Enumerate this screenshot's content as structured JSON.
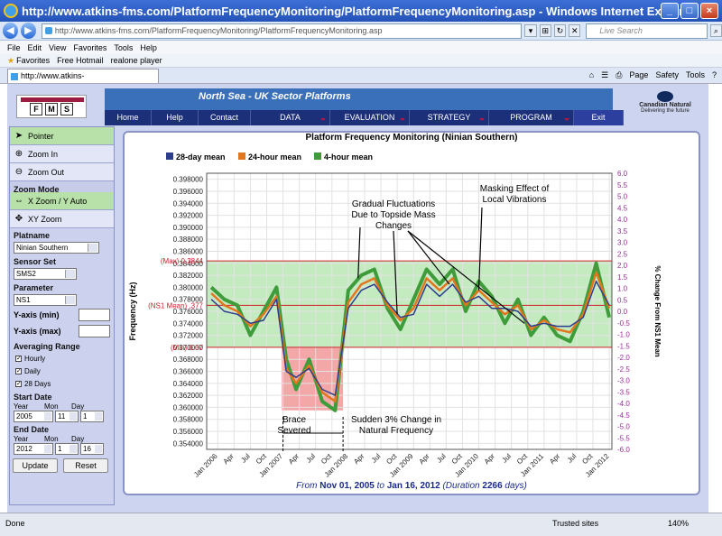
{
  "window": {
    "title": "http://www.atkins-fms.com/PlatformFrequencyMonitoring/PlatformFrequencyMonitoring.asp - Windows Internet Explorer"
  },
  "address": {
    "url": "http://www.atkins-fms.com/PlatformFrequencyMonitoring/PlatformFrequencyMonitoring.asp",
    "search_placeholder": "Live Search"
  },
  "menu": [
    "File",
    "Edit",
    "View",
    "Favorites",
    "Tools",
    "Help"
  ],
  "favorites": [
    "Favorites",
    "Free Hotmail",
    "realone player"
  ],
  "tab": {
    "label": "http://www.atkins-fms.com/PlatformFreque..."
  },
  "commands": [
    "Page",
    "Safety",
    "Tools"
  ],
  "app": {
    "logo_letters": [
      "F",
      "M",
      "S"
    ],
    "brand": "North Sea - UK Sector Platforms",
    "partner": "Canadian Natural",
    "partner_sub": "Delivering the future",
    "nav": [
      "Home",
      "Help",
      "Contact",
      "DATA",
      "EVALUATION",
      "STRATEGY",
      "PROGRAM",
      "Exit"
    ]
  },
  "sidebar": {
    "tools": [
      "Pointer",
      "Zoom In",
      "Zoom Out"
    ],
    "zoom_mode_label": "Zoom Mode",
    "zoom_modes": [
      "X Zoom / Y Auto",
      "XY Zoom"
    ],
    "platname_label": "Platname",
    "platname_value": "Ninian Southern",
    "sensor_label": "Sensor Set",
    "sensor_value": "SMS2",
    "parameter_label": "Parameter",
    "parameter_value": "NS1",
    "ymin_label": "Y-axis (min)",
    "ymax_label": "Y-axis (max)",
    "averaging_label": "Averaging Range",
    "averaging": [
      "Hourly",
      "Daily",
      "28 Days"
    ],
    "start_label": "Start Date",
    "end_label": "End Date",
    "col_labels": [
      "Year",
      "Mon",
      "Day"
    ],
    "start": [
      "2005",
      "11",
      "1"
    ],
    "end": [
      "2012",
      "1",
      "16"
    ],
    "update": "Update",
    "reset": "Reset"
  },
  "chart_title": "Platform Frequency Monitoring (Ninian Southern)",
  "footer": {
    "pre": "From",
    "from": "Nov 01, 2005",
    "mid": "to",
    "to": "Jan 16, 2012",
    "duration_pre": "(Duration",
    "duration": "2266",
    "duration_post": "days)"
  },
  "status": {
    "left": "Done",
    "trusted": "Trusted sites",
    "zoom": "140%"
  },
  "colors": {
    "c28": "#2c3e8c",
    "c24": "#e2761f",
    "c4": "#3e9c3a",
    "bandGreen": "#c4ebc0",
    "bandRed": "#f3a7a7",
    "refLine": "#d0202a",
    "pctAxis": "#9a2d9a"
  },
  "chart_data": {
    "type": "line",
    "title": "Platform Frequency Monitoring (Ninian Southern)",
    "ylabel": "Frequency (Hz)",
    "ylabel_right": "% Change From NS1 Mean",
    "ylim": [
      0.353,
      0.399
    ],
    "ylim_right": [
      -6.0,
      6.0
    ],
    "xlim": [
      "2005-11-01",
      "2012-01-16"
    ],
    "yticks": [
      "0.398000",
      "0.396000",
      "0.394000",
      "0.392000",
      "0.390000",
      "0.388000",
      "0.386000",
      "0.384000",
      "0.382000",
      "0.380000",
      "0.378000",
      "0.376000",
      "0.374000",
      "0.372000",
      "0.370000",
      "0.368000",
      "0.366000",
      "0.364000",
      "0.362000",
      "0.360000",
      "0.358000",
      "0.356000",
      "0.354000"
    ],
    "ytick_values": [
      0.398,
      0.396,
      0.394,
      0.392,
      0.39,
      0.388,
      0.386,
      0.384,
      0.382,
      0.38,
      0.378,
      0.376,
      0.374,
      0.372,
      0.37,
      0.368,
      0.366,
      0.364,
      0.362,
      0.36,
      0.358,
      0.356,
      0.354
    ],
    "yticks_right": [
      "6.0",
      "5.5",
      "5.0",
      "4.5",
      "4.0",
      "3.5",
      "3.0",
      "2.5",
      "2.0",
      "1.5",
      "1.0",
      "0.5",
      "0.0",
      "-0.5",
      "-1.0",
      "-1.5",
      "-2.0",
      "-2.5",
      "-3.0",
      "-3.5",
      "-4.0",
      "-4.5",
      "-5.0",
      "-5.5",
      "-6.0"
    ],
    "xticks": [
      "Jan 2006",
      "Apr",
      "Jul",
      "Oct",
      "Jan 2007",
      "Apr",
      "Jul",
      "Oct",
      "Jan 2008",
      "Apr",
      "Jul",
      "Oct",
      "Jan 2009",
      "Apr",
      "Jul",
      "Oct",
      "Jan 2010",
      "Apr",
      "Jul",
      "Oct",
      "Jan 2011",
      "Apr",
      "Jul",
      "Oct",
      "Jan 2012"
    ],
    "xtick_values": [
      2006.0,
      2006.25,
      2006.5,
      2006.75,
      2007.0,
      2007.25,
      2007.5,
      2007.75,
      2008.0,
      2008.25,
      2008.5,
      2008.75,
      2009.0,
      2009.25,
      2009.5,
      2009.75,
      2010.0,
      2010.25,
      2010.5,
      2010.75,
      2011.0,
      2011.25,
      2011.5,
      2011.75,
      2012.0
    ],
    "x_domain": [
      2005.83,
      2012.04
    ],
    "reference_lines": [
      {
        "label": "(Max) 0.3844",
        "value": 0.3844
      },
      {
        "label": "(NS1 Mean) .377",
        "value": 0.377
      },
      {
        "label": "(Min) 0.37",
        "value": 0.37
      }
    ],
    "series": [
      {
        "name": "28-day mean",
        "x": [
          2005.9,
          2006.1,
          2006.3,
          2006.5,
          2006.7,
          2006.9,
          2007.05,
          2007.2,
          2007.4,
          2007.6,
          2007.8,
          2008.0,
          2008.2,
          2008.4,
          2008.6,
          2008.8,
          2009.0,
          2009.2,
          2009.4,
          2009.6,
          2009.8,
          2010.0,
          2010.2,
          2010.4,
          2010.6,
          2010.8,
          2011.0,
          2011.2,
          2011.4,
          2011.6,
          2011.8,
          2012.0
        ],
        "y": [
          0.378,
          0.376,
          0.3755,
          0.374,
          0.3745,
          0.378,
          0.366,
          0.365,
          0.3665,
          0.363,
          0.362,
          0.3765,
          0.3795,
          0.3805,
          0.3775,
          0.375,
          0.3755,
          0.3805,
          0.3785,
          0.3805,
          0.3775,
          0.3785,
          0.3765,
          0.3765,
          0.376,
          0.3735,
          0.374,
          0.3735,
          0.3735,
          0.375,
          0.381,
          0.377
        ]
      },
      {
        "name": "24-hour mean",
        "x": [
          2005.9,
          2006.1,
          2006.3,
          2006.5,
          2006.7,
          2006.9,
          2007.05,
          2007.2,
          2007.4,
          2007.6,
          2007.8,
          2008.0,
          2008.2,
          2008.4,
          2008.6,
          2008.8,
          2009.0,
          2009.2,
          2009.4,
          2009.6,
          2009.8,
          2010.0,
          2010.2,
          2010.4,
          2010.6,
          2010.8,
          2011.0,
          2011.2,
          2011.4,
          2011.6,
          2011.8,
          2012.0
        ],
        "y": [
          0.379,
          0.377,
          0.376,
          0.3735,
          0.3755,
          0.3785,
          0.3665,
          0.364,
          0.367,
          0.3625,
          0.361,
          0.3775,
          0.3805,
          0.3815,
          0.377,
          0.3745,
          0.3765,
          0.3815,
          0.3795,
          0.3815,
          0.377,
          0.3795,
          0.3775,
          0.3755,
          0.377,
          0.373,
          0.3745,
          0.373,
          0.3725,
          0.3755,
          0.3825,
          0.3765
        ]
      },
      {
        "name": "4-hour mean",
        "x": [
          2005.9,
          2006.1,
          2006.3,
          2006.5,
          2006.7,
          2006.9,
          2007.05,
          2007.2,
          2007.4,
          2007.6,
          2007.8,
          2008.0,
          2008.2,
          2008.4,
          2008.6,
          2008.8,
          2009.0,
          2009.2,
          2009.4,
          2009.6,
          2009.8,
          2010.0,
          2010.2,
          2010.4,
          2010.6,
          2010.8,
          2011.0,
          2011.2,
          2011.4,
          2011.6,
          2011.8,
          2012.0
        ],
        "y": [
          0.38,
          0.378,
          0.377,
          0.372,
          0.376,
          0.38,
          0.368,
          0.363,
          0.368,
          0.361,
          0.3595,
          0.3795,
          0.382,
          0.383,
          0.3765,
          0.373,
          0.378,
          0.383,
          0.3805,
          0.383,
          0.376,
          0.381,
          0.3785,
          0.374,
          0.378,
          0.372,
          0.375,
          0.372,
          0.371,
          0.376,
          0.384,
          0.375
        ]
      }
    ],
    "legend": {
      "placement": "top-left",
      "items": [
        "28-day mean",
        "24-hour mean",
        "4-hour mean"
      ]
    },
    "annotations": [
      {
        "lines": [
          "Gradual Fluctuations",
          "Due to Topside Mass",
          "Changes"
        ]
      },
      {
        "lines": [
          "Masking Effect of",
          "Local Vibrations"
        ]
      },
      {
        "lines": [
          "Brace",
          "Severed"
        ]
      },
      {
        "lines": [
          "Sudden 3% Change in",
          "Natural Frequency"
        ]
      }
    ]
  }
}
